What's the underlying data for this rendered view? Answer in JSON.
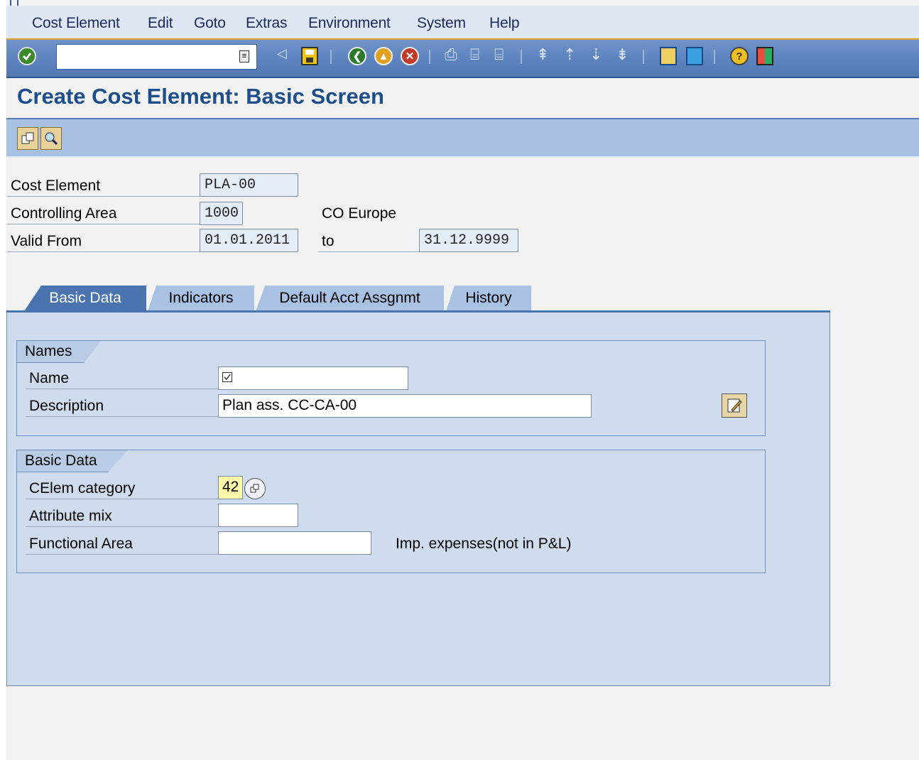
{
  "menu": {
    "items": [
      "Cost Element",
      "Edit",
      "Goto",
      "Extras",
      "Environment",
      "System",
      "Help"
    ]
  },
  "toolbar": {
    "command_field_value": "",
    "icons": [
      "enter-icon",
      "back-arrow-icon",
      "save-icon",
      "back-icon",
      "exit-icon",
      "cancel-icon",
      "print-icon",
      "find-icon",
      "find-next-icon",
      "first-page-icon",
      "previous-page-icon",
      "next-page-icon",
      "last-page-icon",
      "create-session-icon",
      "shortcut-icon",
      "help-icon",
      "customize-layout-icon"
    ]
  },
  "title": "Create Cost Element: Basic Screen",
  "header": {
    "cost_element_label": "Cost Element",
    "cost_element_value": "PLA-00",
    "controlling_area_label": "Controlling Area",
    "controlling_area_value": "1000",
    "controlling_area_text": "CO Europe",
    "valid_from_label": "Valid From",
    "valid_from_value": "01.01.2011",
    "to_label": "to",
    "valid_to_value": "31.12.9999"
  },
  "tabs": [
    "Basic Data",
    "Indicators",
    "Default Acct Assgnmt",
    "History"
  ],
  "active_tab": "Basic Data",
  "names_group": {
    "title": "Names",
    "name_label": "Name",
    "name_value": "",
    "description_label": "Description",
    "description_value": "Plan ass. CC-CA-00"
  },
  "basic_data_group": {
    "title": "Basic Data",
    "category_label": "CElem category",
    "category_value": "42",
    "attribute_mix_label": "Attribute mix",
    "attribute_mix_value": "",
    "functional_area_label": "Functional Area",
    "functional_area_value": "",
    "category_text": "Imp. expenses(not in P&L)"
  },
  "colors": {
    "title": "#1d4e8a",
    "toolbar": "#5b82bd",
    "menubar": "#dfe6f4",
    "accent": "#e8a13a",
    "panel": "#cfdced"
  }
}
